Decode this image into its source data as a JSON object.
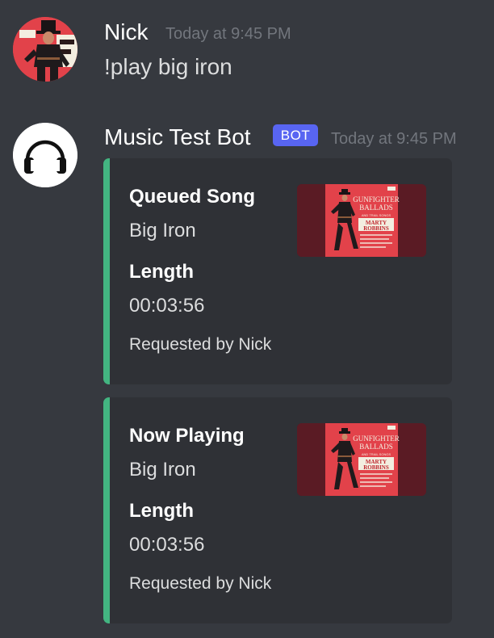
{
  "messages": [
    {
      "username": "Nick",
      "timestamp": "Today at 9:45 PM",
      "text": "!play big iron",
      "avatar": "cowboy-photo-avatar"
    },
    {
      "username": "Music Test Bot",
      "badge": "BOT",
      "timestamp": "Today at 9:45 PM",
      "avatar": "headphones-icon"
    }
  ],
  "embeds": [
    {
      "title": "Queued Song",
      "song": "Big Iron",
      "field_name": "Length",
      "field_value": "00:03:56",
      "footer": "Requested by Nick",
      "accent": "#43b581",
      "thumbnail": "album-cover-thumbnail"
    },
    {
      "title": "Now Playing",
      "song": "Big Iron",
      "field_name": "Length",
      "field_value": "00:03:56",
      "footer": "Requested by Nick",
      "accent": "#43b581",
      "thumbnail": "album-cover-thumbnail"
    }
  ],
  "album_cover": {
    "line1": "GUNFIGHTER",
    "line2": "BALLADS",
    "line3": "AND TRAIL SONGS",
    "artist1": "MARTY",
    "artist2": "ROBBINS"
  },
  "colors": {
    "background": "#36393f",
    "embed_background": "#2f3136",
    "embed_accent": "#43b581",
    "bot_badge": "#5865f2",
    "album_red": "#e2424a"
  }
}
